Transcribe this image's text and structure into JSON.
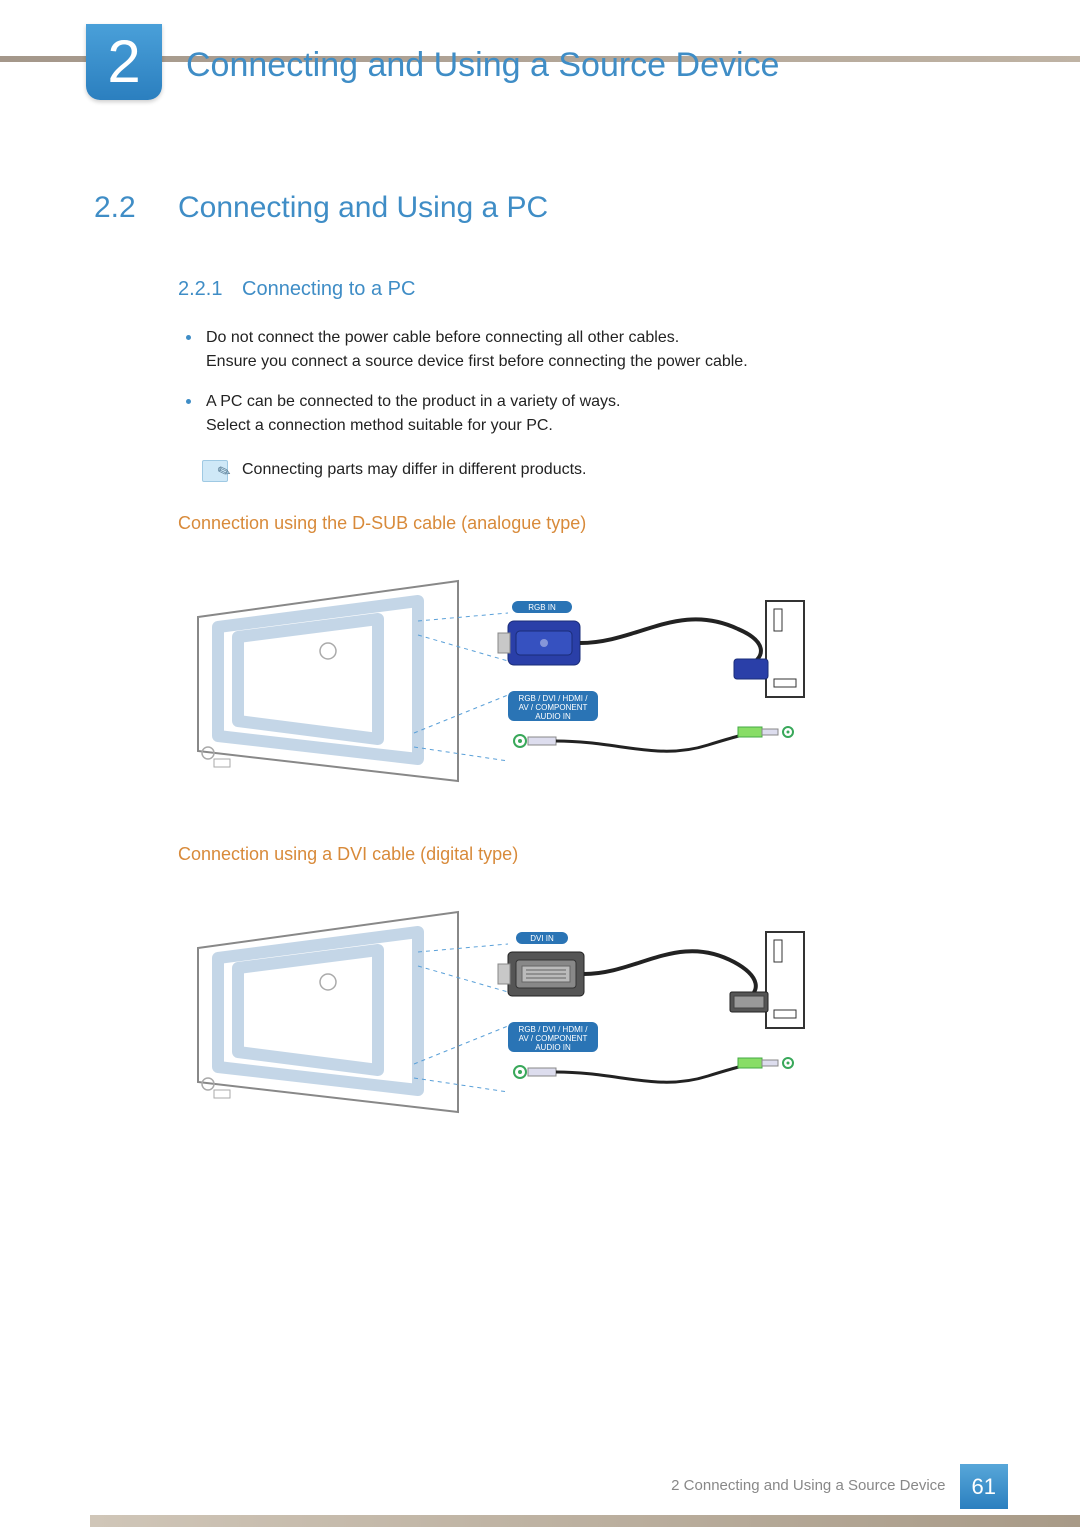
{
  "chapter": {
    "number": "2",
    "title": "Connecting and Using a Source Device"
  },
  "section": {
    "number": "2.2",
    "title": "Connecting and Using a PC"
  },
  "subsection": {
    "number": "2.2.1",
    "title": "Connecting to a PC"
  },
  "bullets": [
    {
      "line1": "Do not connect the power cable before connecting all other cables.",
      "line2": "Ensure you connect a source device first before connecting the power cable."
    },
    {
      "line1": "A PC can be connected to the product in a variety of ways.",
      "line2": "Select a connection method suitable for your PC."
    }
  ],
  "note": "Connecting parts may differ in different products.",
  "diagram1": {
    "heading": "Connection using the D-SUB cable (analogue type)",
    "port_top": "RGB IN",
    "port_bottom_l1": "RGB / DVI / HDMI /",
    "port_bottom_l2": "AV / COMPONENT",
    "port_bottom_l3": "AUDIO IN"
  },
  "diagram2": {
    "heading": "Connection using a DVI cable (digital type)",
    "port_top": "DVI IN",
    "port_bottom_l1": "RGB / DVI / HDMI /",
    "port_bottom_l2": "AV / COMPONENT",
    "port_bottom_l3": "AUDIO IN"
  },
  "footer": {
    "chapter_ref": "2 Connecting and Using a Source Device",
    "page": "61"
  }
}
